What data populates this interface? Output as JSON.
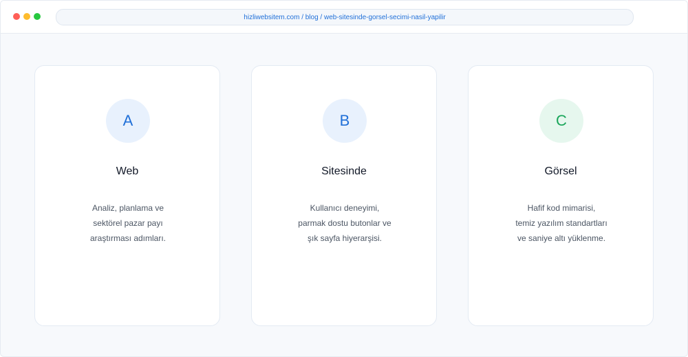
{
  "browser": {
    "url": "hizliwebsitem.com / blog / web-sitesinde-gorsel-secimi-nasil-yapilir"
  },
  "cards": [
    {
      "badge": "A",
      "title": "Web",
      "lines": [
        "Analiz, planlama ve",
        "sektörel pazar payı",
        "araştırması adımları."
      ]
    },
    {
      "badge": "B",
      "title": "Sitesinde",
      "lines": [
        "Kullanıcı deneyimi,",
        "parmak dostu butonlar ve",
        "şık sayfa hiyerarşisi."
      ]
    },
    {
      "badge": "C",
      "title": "Görsel",
      "lines": [
        "Hafif kod mimarisi,",
        "temiz yazılım standartları",
        "ve saniye altı yüklenme."
      ]
    }
  ],
  "colors": {
    "accent_blue": "#1f6fd8",
    "accent_green": "#1aa65a"
  }
}
